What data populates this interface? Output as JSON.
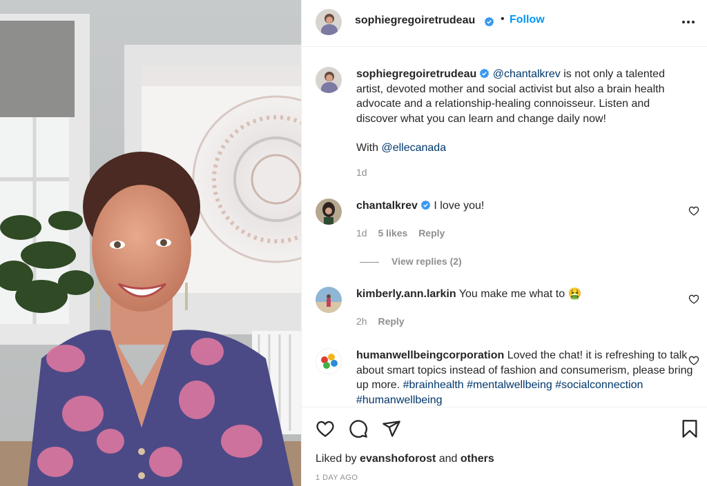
{
  "post": {
    "author": "sophiegregoiretrudeau",
    "follow_label": "Follow",
    "dot": "•",
    "caption": {
      "mention": "@chantalkrev",
      "text": " is not only a talented artist, devoted mother and social activist but also a brain health advocate and a relationship-healing connoisseur. Listen and discover what you can learn and change daily now!",
      "with_label": "With ",
      "with_mention": "@ellecanada",
      "age": "1d"
    }
  },
  "comments": [
    {
      "user": "chantalkrev",
      "verified": true,
      "text": "I love you!",
      "age": "1d",
      "likes": "5 likes",
      "reply_label": "Reply",
      "view_replies": "View replies (2)"
    },
    {
      "user": "kimberly.ann.larkin",
      "verified": false,
      "text": "You make me what to 🤮",
      "age": "2h",
      "reply_label": "Reply"
    },
    {
      "user": "humanwellbeingcorporation",
      "verified": false,
      "text": "Loved the chat! it is refreshing to talk about smart topics instead of fashion and consumerism, please bring up more. ",
      "tags": "#brainhealth #mentalwellbeing #socialconnection #humanwellbeing"
    }
  ],
  "footer": {
    "liked_by_prefix": "Liked by ",
    "liked_by_user": "evanshoforost",
    "liked_by_and": " and ",
    "liked_by_others": "others",
    "time_ago": "1 DAY AGO"
  },
  "icons": {
    "verified": "verified-badge-icon",
    "more": "more-options-icon",
    "like": "heart-icon",
    "comment": "comment-icon",
    "share": "share-plane-icon",
    "save": "bookmark-icon"
  },
  "colors": {
    "link": "#0095f6",
    "mention": "#00376b",
    "muted": "#8e8e8e",
    "text": "#262626",
    "verified": "#3897f0"
  }
}
